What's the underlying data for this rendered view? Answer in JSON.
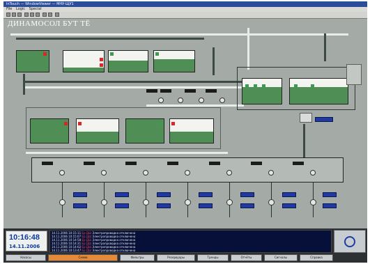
{
  "window": {
    "title": "InTouch — WindowViewer — МНУ-ЩУ1",
    "menu": [
      "File",
      "Logic",
      "Special"
    ]
  },
  "screen_title": "ДИНАМОСОЛ БУТ ТЁ",
  "clock": {
    "time": "10:16:48",
    "date": "14.11.2006"
  },
  "alarm_log": [
    {
      "time": "14.11.2006 10:15:11",
      "code": "Ер ДШ",
      "text": "Электропроводка отключена"
    },
    {
      "time": "14.11.2006 10:15:07",
      "code": "Ер ДШ",
      "text": "Электропроводка отключена"
    },
    {
      "time": "14.11.2006 10:14:58",
      "code": "Ер ДШ",
      "text": "Электропроводка отключена"
    },
    {
      "time": "14.11.2006 10:14:31",
      "code": "Ер ДШ",
      "text": "Электропроводка отключена"
    },
    {
      "time": "14.11.2006 10:14:02",
      "code": "Ер ДШ",
      "text": "Электропроводка отключена"
    },
    {
      "time": "14.11.2006 10:13:47",
      "code": "Ер ДШ",
      "text": "Электропроводка отключена"
    }
  ],
  "nav_buttons": [
    "Насосы",
    "Схема",
    "Фильтры",
    "Резервуары",
    "Тренды",
    "Отчёты",
    "Сигналы",
    "Справка"
  ],
  "colors": {
    "tank_fill": "#4f8f55",
    "alarm_red": "#d8262b",
    "ok_green": "#3c9a52",
    "display_blue": "#1f3aa0",
    "log_bg": "#061038"
  }
}
